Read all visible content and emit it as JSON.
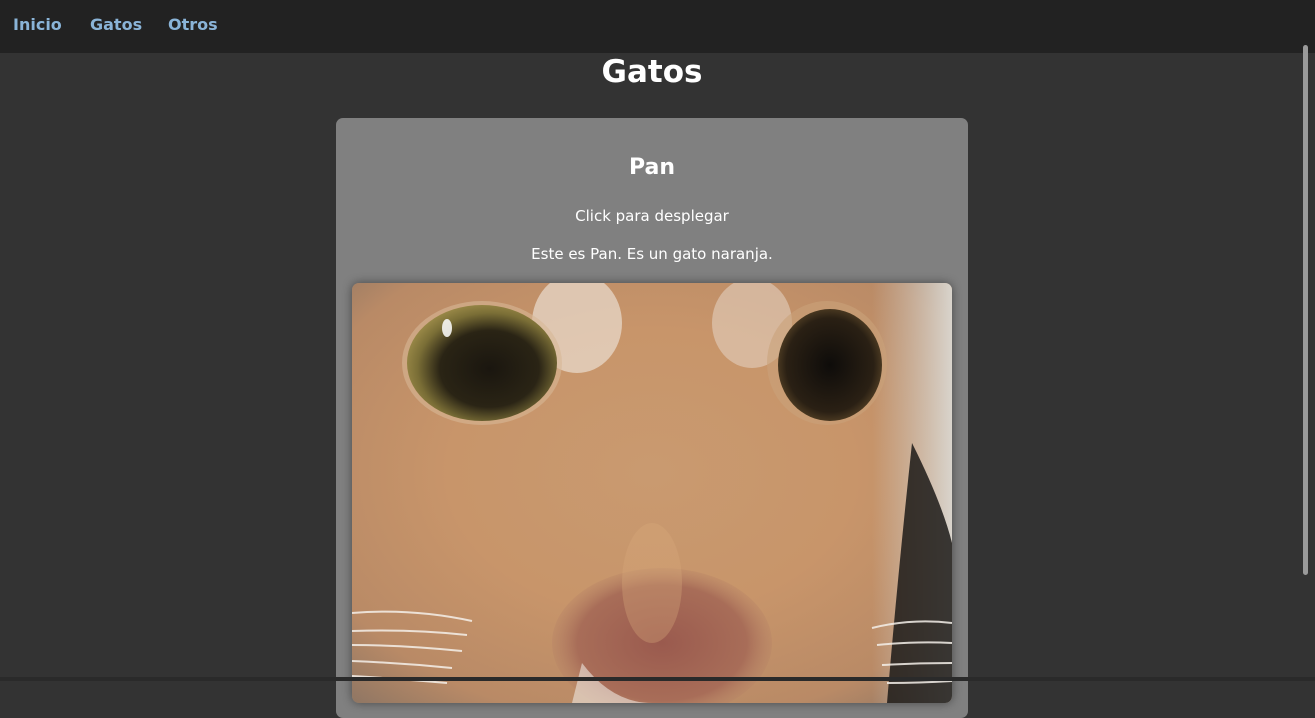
{
  "nav": {
    "items": [
      {
        "label": "Inicio"
      },
      {
        "label": "Gatos"
      },
      {
        "label": "Otros"
      }
    ],
    "link_color": "#8ab4d8"
  },
  "page": {
    "title": "Gatos"
  },
  "card": {
    "title": "Pan",
    "toggle_text": "Click para desplegar",
    "description": "Este es Pan. Es un gato naranja.",
    "image_subject": "orange-cat-closeup"
  },
  "colors": {
    "background": "#333333",
    "navbar": "#222222",
    "card": "#808080"
  }
}
